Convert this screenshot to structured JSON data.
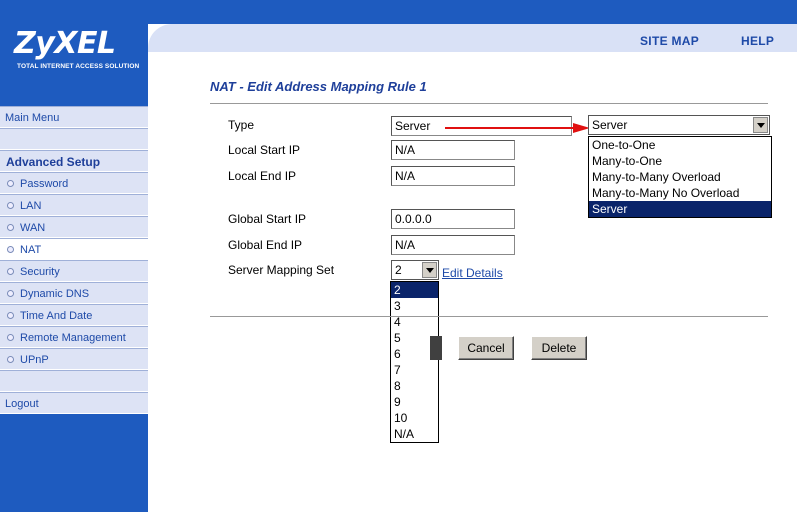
{
  "brand": {
    "name": "ZyXEL",
    "tagline": "TOTAL INTERNET ACCESS SOLUTION"
  },
  "top_links": {
    "site_map": "SITE MAP",
    "help": "HELP"
  },
  "sidebar": {
    "main_menu": "Main Menu",
    "section": "Advanced Setup",
    "items": [
      "Password",
      "LAN",
      "WAN",
      "NAT",
      "Security",
      "Dynamic DNS",
      "Time And Date",
      "Remote Management",
      "UPnP"
    ],
    "logout": "Logout"
  },
  "page": {
    "title": "NAT - Edit Address Mapping Rule 1"
  },
  "form": {
    "type_label": "Type",
    "type_value": "Server",
    "local_start_label": "Local Start IP",
    "local_start_value": "N/A",
    "local_end_label": "Local End IP",
    "local_end_value": "N/A",
    "global_start_label": "Global Start IP",
    "global_start_value": "0.0.0.0",
    "global_end_label": "Global End IP",
    "global_end_value": "N/A",
    "server_set_label": "Server Mapping Set",
    "server_set_value": "2",
    "edit_details": "Edit Details"
  },
  "type_select": {
    "value": "Server",
    "options": [
      "One-to-One",
      "Many-to-One",
      "Many-to-Many Overload",
      "Many-to-Many No Overload",
      "Server"
    ],
    "selected_index": 4
  },
  "server_set_options": [
    "2",
    "3",
    "4",
    "5",
    "6",
    "7",
    "8",
    "9",
    "10",
    "N/A"
  ],
  "buttons": {
    "cancel": "Cancel",
    "delete": "Delete"
  },
  "colors": {
    "nav_blue": "#1e5bbf",
    "highlight": "#0a246a",
    "arrow": "#e01010"
  }
}
